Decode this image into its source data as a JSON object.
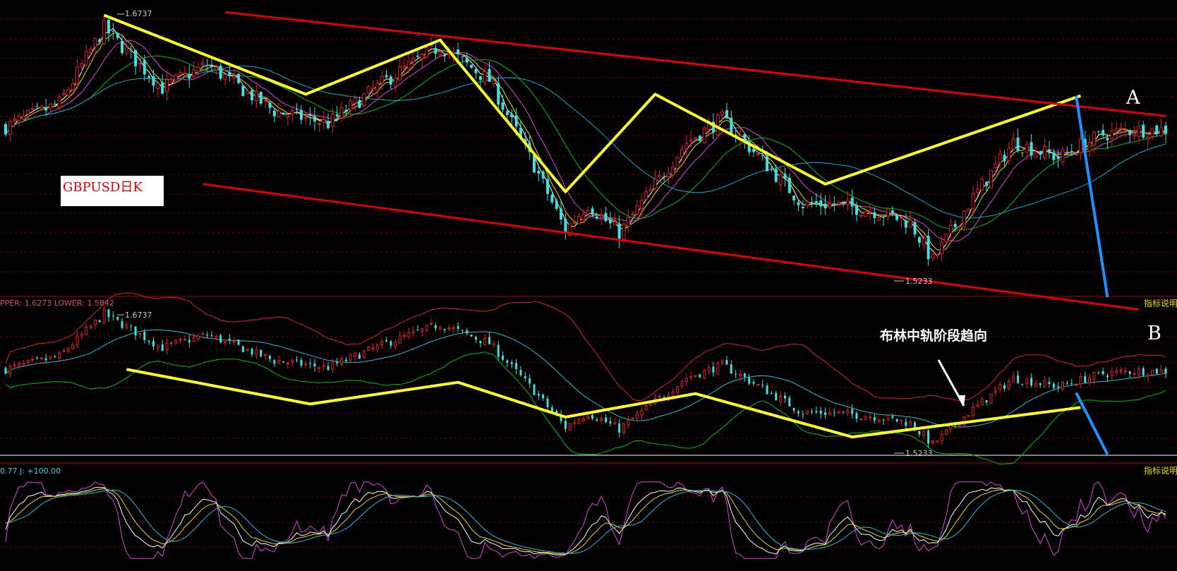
{
  "app": {
    "window_title": "GBPUSD日K"
  },
  "chart_data": [
    {
      "panel": "price",
      "type": "candlestick",
      "title": "GBPUSD日K",
      "max_label": "1.6737",
      "min_label": "1.5233",
      "ylim": [
        1.505,
        1.685
      ],
      "annotations": {
        "point_a": "A",
        "point_b": "B"
      },
      "ma_colors": [
        "#ffffff",
        "#e8e000",
        "#e040e0",
        "#00c000",
        "#00b0d0"
      ],
      "trend_color": "#ffff20",
      "channel_color": "#e00000",
      "projection_color": "#1e90ff"
    },
    {
      "panel": "boll",
      "type": "candlestick",
      "indicator_text": "PPER: 1.6273 LOWER: 1.5842",
      "upper_value": "1.6273",
      "lower_value": "1.5842",
      "max_label": "1.6737",
      "min_label": "1.5233",
      "annotation_text": "布林中轨阶段趋向",
      "band_colors": {
        "upper": "#e02020",
        "mid": "#20c0e0",
        "lower": "#00c000"
      }
    },
    {
      "panel": "kdj",
      "type": "line",
      "indicator_text": "0.77 J: +100.00",
      "j_value": 100.0,
      "ylim": [
        -10,
        110
      ],
      "line_colors": {
        "k": "#ffffff",
        "d": "#e8e000",
        "j": "#e040e0",
        "ma": "#20c0e0"
      }
    }
  ],
  "ui": {
    "help_label": "指标说明",
    "up_color": "#e02020",
    "down_color": "#40e0e0"
  }
}
